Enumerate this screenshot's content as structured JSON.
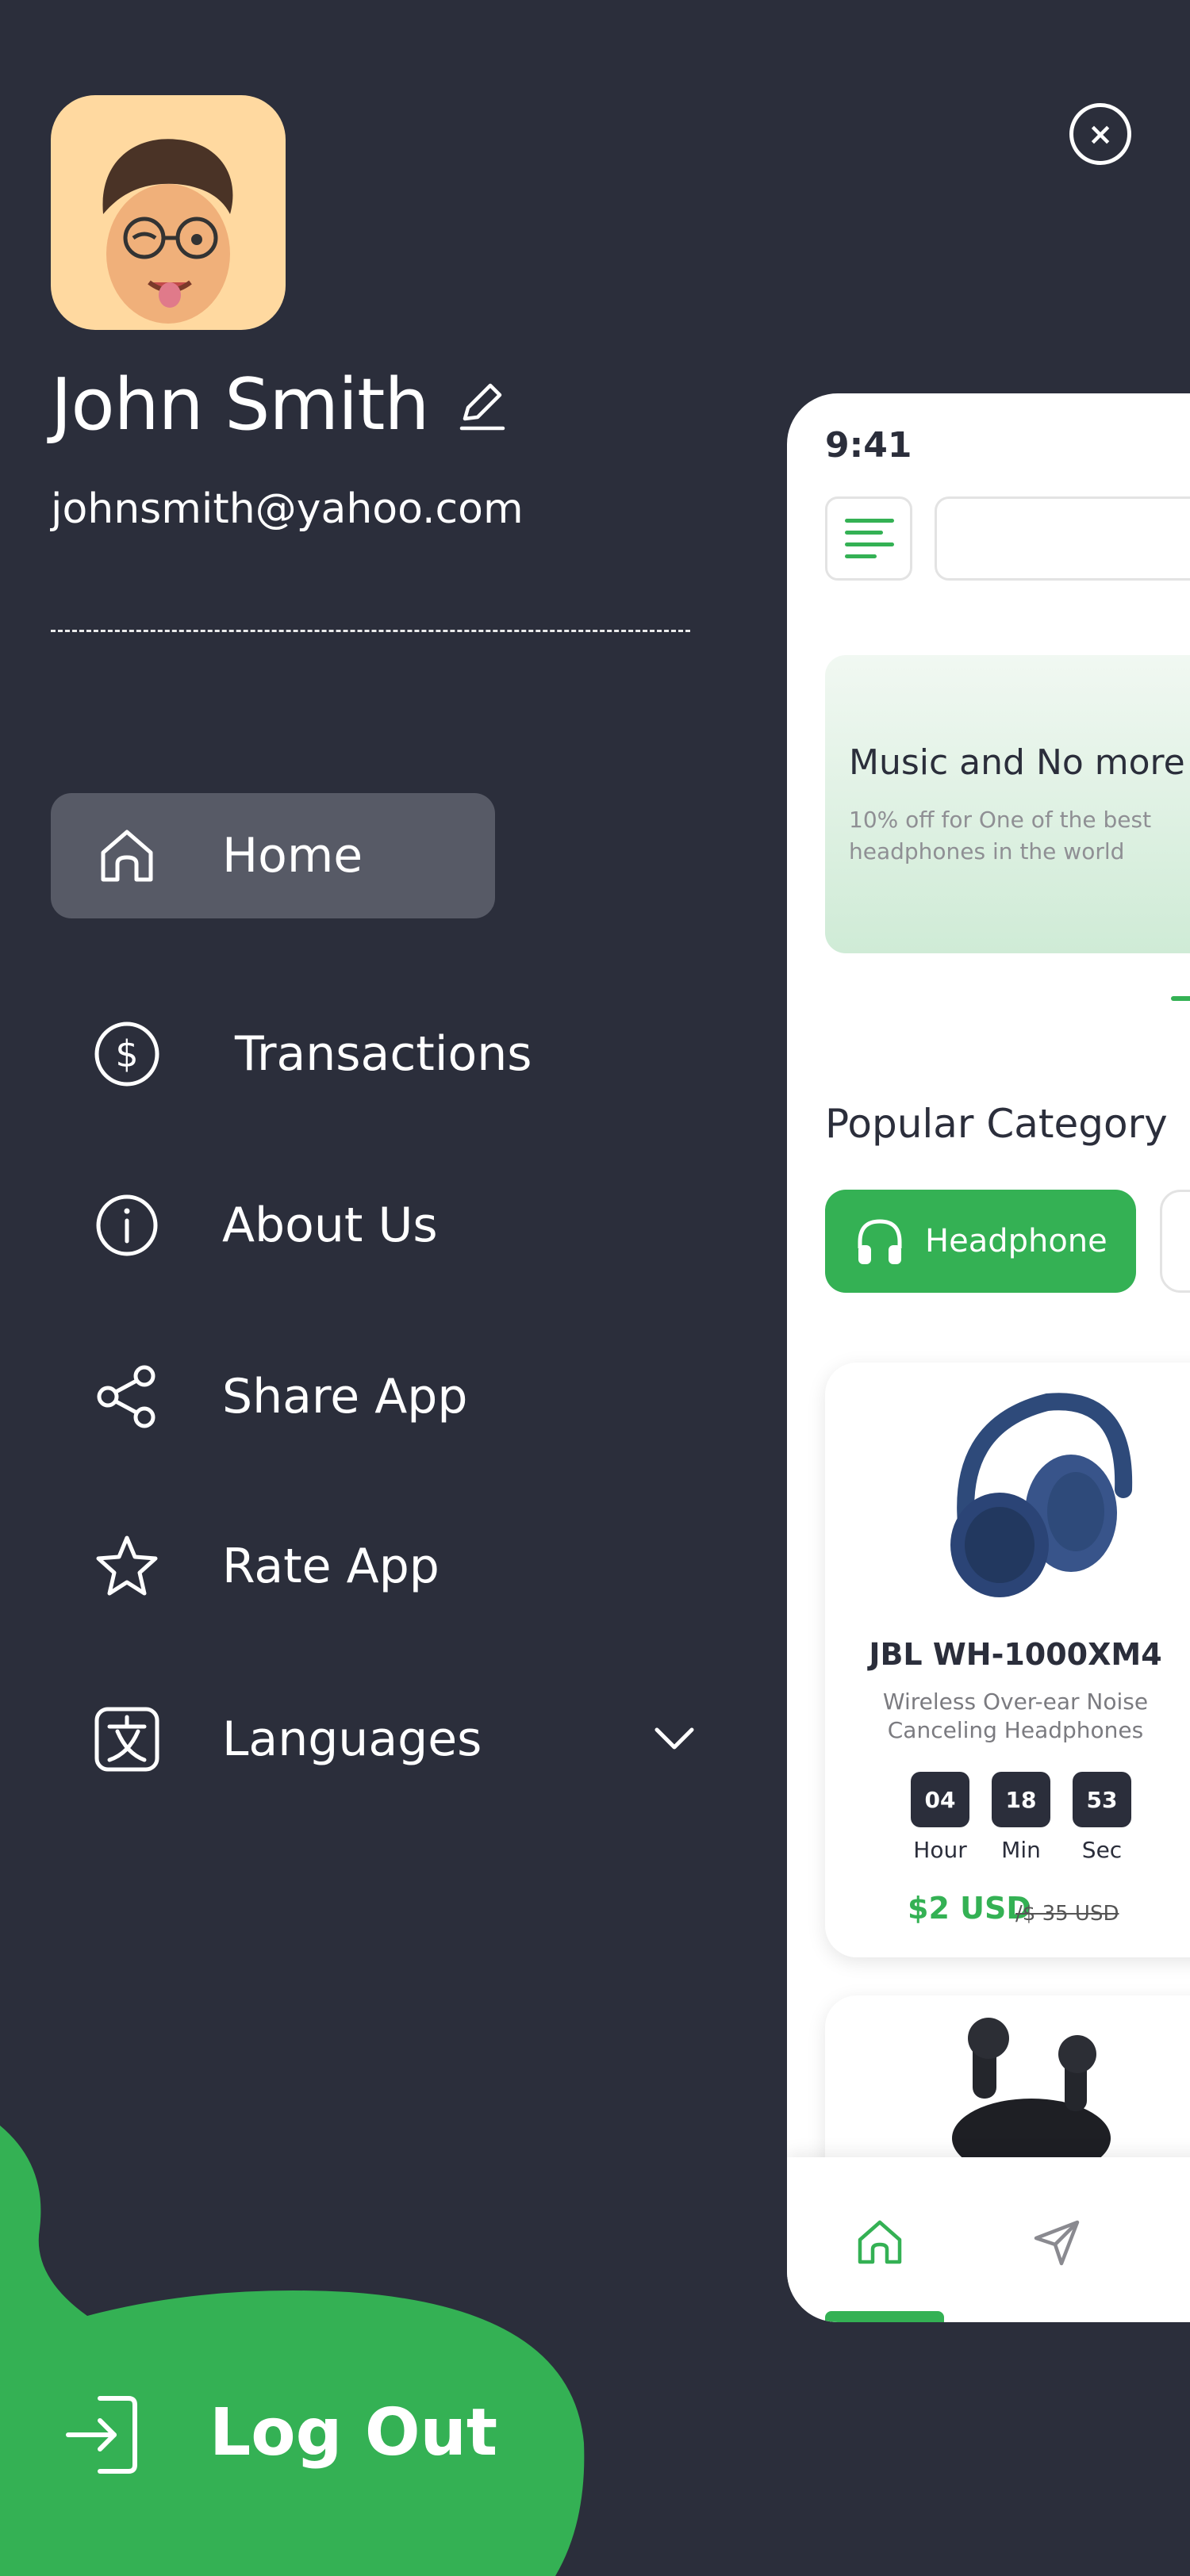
{
  "profile": {
    "name": "John Smith",
    "email": "johnsmith@yahoo.com"
  },
  "icons": {
    "close": "close-icon",
    "edit": "edit-pencil-icon",
    "logout": "logout-icon"
  },
  "menu": {
    "items": [
      {
        "label": "Home",
        "icon": "home-icon",
        "active": true
      },
      {
        "label": "Transactions",
        "icon": "dollar-icon",
        "active": false
      },
      {
        "label": "About Us",
        "icon": "info-icon",
        "active": false
      },
      {
        "label": "Share App",
        "icon": "share-icon",
        "active": false
      },
      {
        "label": "Rate App",
        "icon": "star-icon",
        "active": false
      },
      {
        "label": "Languages",
        "icon": "translate-icon",
        "active": false,
        "expandable": true
      }
    ],
    "logout_label": "Log Out"
  },
  "preview": {
    "status_time": "9:41",
    "banner": {
      "title": "Music and No more",
      "subtitle": "10% off for One of the best headphones in the world"
    },
    "section_title": "Popular Category",
    "chip_label": "Headphone",
    "product": {
      "name": "JBL WH-1000XM4",
      "description": "Wireless Over-ear Noise Canceling Headphones",
      "timer": {
        "hours": "04",
        "hours_label": "Hour",
        "minutes": "18",
        "minutes_label": "Min",
        "seconds": "53",
        "seconds_label": "Sec"
      },
      "price": "$2 USD",
      "old_price": "/$ 35 USD"
    }
  },
  "colors": {
    "background": "#2b2e3b",
    "accent": "#34b154",
    "active_item": "#575a66",
    "white": "#ffffff"
  }
}
